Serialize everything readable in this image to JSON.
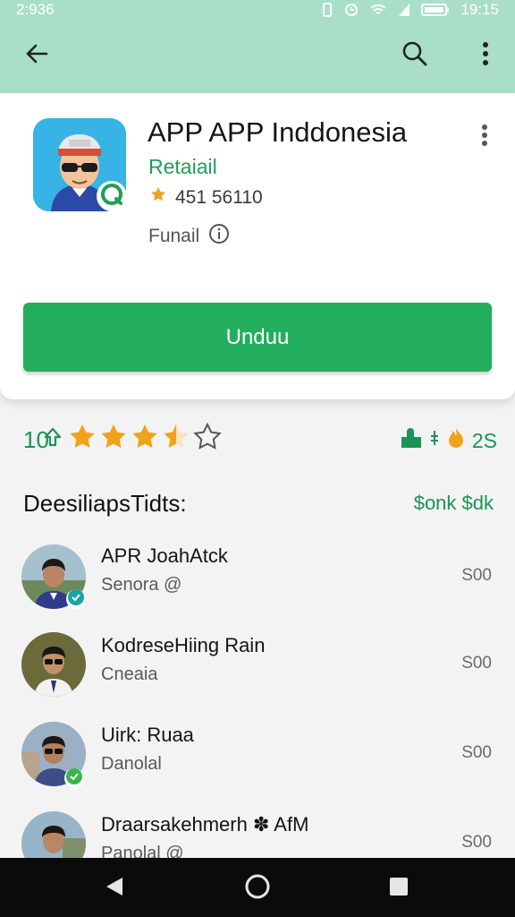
{
  "status_bar": {
    "time": "2:936",
    "clock_right": "19:15"
  },
  "app": {
    "title": "APP APP Inddonesia",
    "category": "Retaiail",
    "stats": "451 56110",
    "status_label": "Funail"
  },
  "install_button": {
    "label": "Unduu"
  },
  "rating": {
    "count_label": "10",
    "stars_filled": 3.5,
    "stars_total": 5,
    "right_label": "2S"
  },
  "section": {
    "title": "DeesiliapsTidts:",
    "link": "$onk $dk"
  },
  "developers": [
    {
      "name": "APR JoahAtck",
      "role": "Senora @",
      "price": "S00",
      "badge": "teal"
    },
    {
      "name": "KodreseHiing Rain",
      "role": "Cneaia",
      "price": "S00",
      "badge": ""
    },
    {
      "name": "Uirk: Ruaa",
      "role": "Danolal",
      "price": "S00",
      "badge": "green"
    },
    {
      "name": "Draarsakehmerh ✽ AfM",
      "role": "Panolal @",
      "price": "S00",
      "badge": ""
    }
  ],
  "colors": {
    "accent_green": "#22ae5c",
    "header_mint": "#a9dfc6",
    "star_orange": "#f1a21c"
  },
  "icons": {
    "appbar": [
      "back-arrow-icon",
      "search-icon",
      "more-vert-icon"
    ],
    "nav": [
      "nav-back-icon",
      "nav-home-icon",
      "nav-recents-icon"
    ]
  }
}
